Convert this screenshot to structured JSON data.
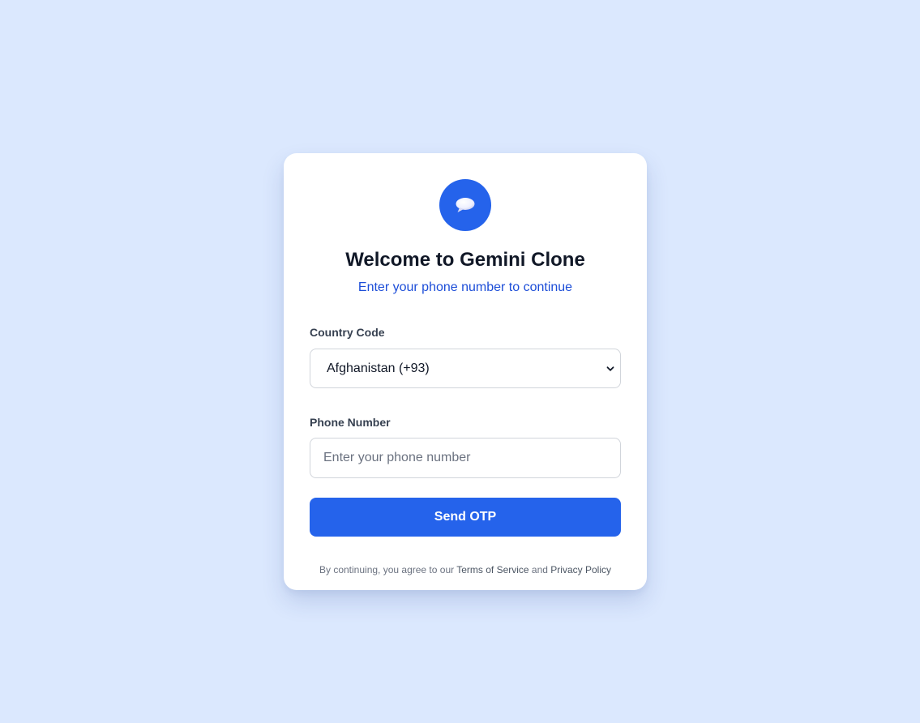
{
  "login": {
    "title": "Welcome to Gemini Clone",
    "subtitle": "Enter your phone number to continue",
    "country": {
      "label": "Country Code",
      "selected": "Afghanistan (+93)"
    },
    "phone": {
      "label": "Phone Number",
      "value": "",
      "placeholder": "Enter your phone number"
    },
    "submit_label": "Send OTP",
    "legal": {
      "prefix": "By continuing, you agree to our ",
      "terms": "Terms of Service",
      "and": " and ",
      "privacy": "Privacy Policy"
    }
  },
  "icons": {
    "logo": "chat-bubble-icon",
    "select_caret": "chevron-down-icon"
  },
  "colors": {
    "page_background": "#dbe8fe",
    "accent": "#2563eb",
    "subtitle": "#1d4ed8",
    "title": "#111827"
  }
}
